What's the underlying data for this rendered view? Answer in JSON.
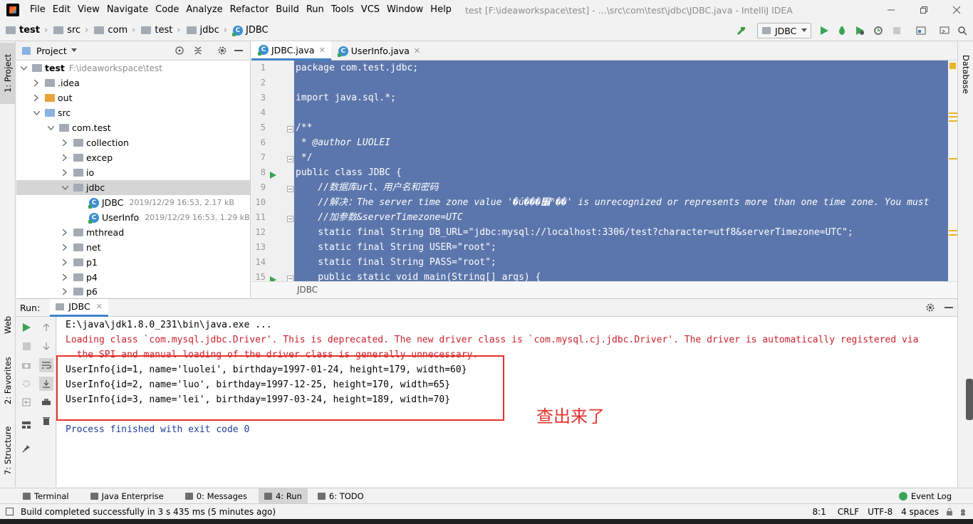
{
  "menu": {
    "items": [
      "File",
      "Edit",
      "View",
      "Navigate",
      "Code",
      "Analyze",
      "Refactor",
      "Build",
      "Run",
      "Tools",
      "VCS",
      "Window",
      "Help"
    ],
    "window_title": "test [F:\\ideaworkspace\\test] - ...\\src\\com\\test\\jdbc\\JDBC.java - IntelliJ IDEA"
  },
  "breadcrumb": [
    "test",
    "src",
    "com",
    "test",
    "jdbc",
    "JDBC"
  ],
  "toolbar": {
    "run_config": "JDBC"
  },
  "project": {
    "title": "Project",
    "root_name": "test",
    "root_path": "F:\\ideaworkspace\\test",
    "nodes": [
      ".idea",
      "out",
      "src",
      "com.test",
      "collection",
      "excep",
      "io",
      "jdbc"
    ],
    "files": [
      {
        "name": "JDBC",
        "meta": "2019/12/29 16:53, 2.17 kB"
      },
      {
        "name": "UserInfo",
        "meta": "2019/12/29 16:53, 1.29 kB"
      }
    ],
    "more": [
      "mthread",
      "net",
      "p1",
      "p4",
      "p6"
    ]
  },
  "left_stripe": {
    "project": "1: Project",
    "web": "Web",
    "favorites": "2: Favorites",
    "structure": "7: Structure"
  },
  "right_stripe": {
    "database": "Database"
  },
  "editor": {
    "tabs": [
      "JDBC.java",
      "UserInfo.java"
    ],
    "line_numbers": [
      "1",
      "2",
      "3",
      "4",
      "5",
      "6",
      "7",
      "8",
      "9",
      "10",
      "11",
      "12",
      "13",
      "14",
      "15"
    ],
    "lines": [
      "package com.test.jdbc;",
      "",
      "import java.sql.*;",
      "",
      "/**",
      " * @author LUOLEI",
      " */",
      "public class JDBC {",
      "    //数据库url、用户名和密码",
      "    //解决：The server time zone value '�ú���׼ʱ��' is unrecognized or represents more than one time zone. You must",
      "    //加参数&serverTimezone=UTC",
      "    static final String DB_URL=\"jdbc:mysql://localhost:3306/test?character=utf8&serverTimezone=UTC\";",
      "    static final String USER=\"root\";",
      "    static final String PASS=\"root\";",
      "    public static void main(String[] args) {"
    ],
    "breadcrumb_footer": "JDBC"
  },
  "run": {
    "label": "Run:",
    "tab": "JDBC",
    "output": {
      "cmd": "E:\\java\\jdk1.8.0_231\\bin\\java.exe ...",
      "warn1": "Loading class `com.mysql.jdbc.Driver'. This is deprecated. The new driver class is `com.mysql.cj.jdbc.Driver'. The driver is automatically registered via",
      "warn2": "  the SPI and manual loading of the driver class is generally unnecessary.",
      "rows": [
        "UserInfo{id=1, name='luolei', birthday=1997-01-24, height=179, width=60}",
        "UserInfo{id=2, name='luo', birthday=1997-12-25, height=170, width=65}",
        "UserInfo{id=3, name='lei', birthday=1997-03-24, height=189, width=70}"
      ],
      "finished": "Process finished with exit code 0"
    },
    "annotation": "查出来了"
  },
  "tool_windows": [
    "Terminal",
    "Java Enterprise",
    "0: Messages",
    "4: Run",
    "6: TODO"
  ],
  "event_log": "Event Log",
  "status": {
    "message": "Build completed successfully in 3 s 435 ms (5 minutes ago)",
    "position": "8:1",
    "line_sep": "CRLF",
    "encoding": "UTF-8",
    "indent": "4 spaces"
  },
  "colors": {
    "selection": "#5b76ac",
    "error": "#c7222d",
    "annotation": "#e5322d",
    "accent": "#4083c9"
  }
}
